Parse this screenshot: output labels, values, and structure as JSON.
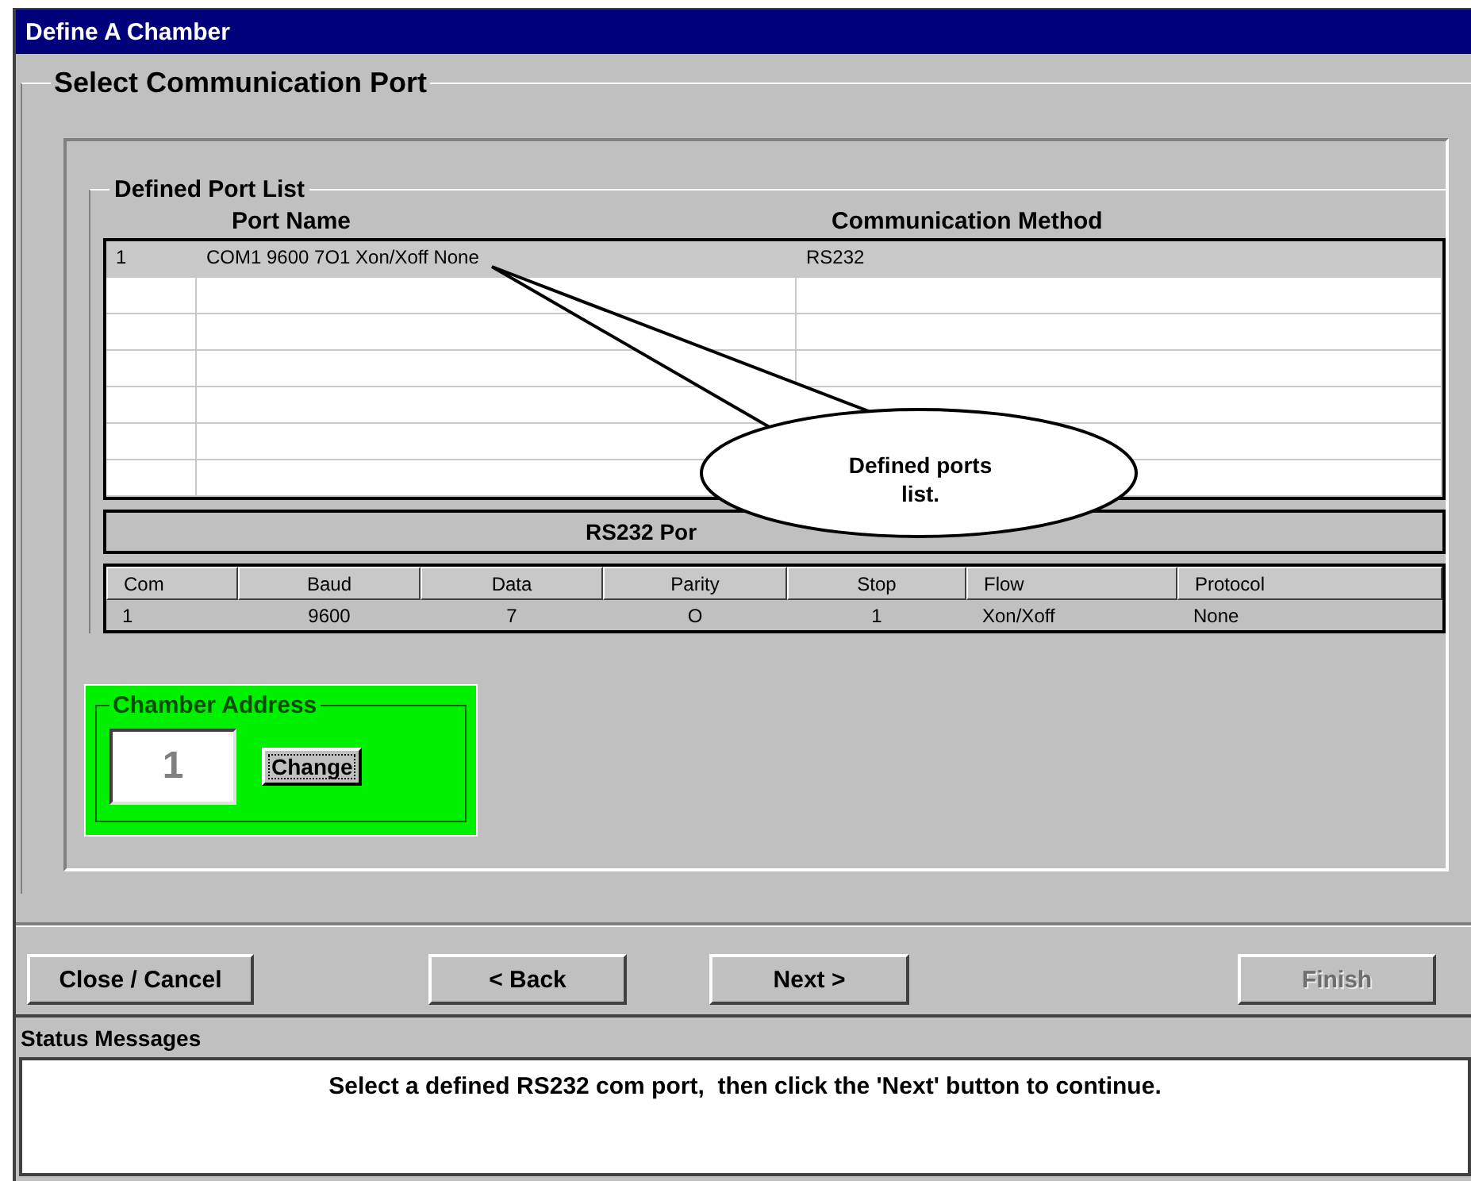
{
  "window": {
    "title": "Define A Chamber"
  },
  "section_title": "Select Communication Port",
  "port_list": {
    "title": "Defined Port List",
    "columns": [
      "Port Name",
      "Communication Method"
    ],
    "rows": [
      {
        "number": "1",
        "port_name": "COM1 9600 7O1 Xon/Xoff None",
        "method": "RS232",
        "selected": true
      }
    ],
    "callout": "Defined ports list."
  },
  "rs232": {
    "title": "RS232 Por",
    "columns": [
      "Com",
      "Baud",
      "Data",
      "Parity",
      "Stop",
      "Flow",
      "Protocol"
    ],
    "rows": [
      [
        "1",
        "9600",
        "7",
        "O",
        "1",
        "Xon/Xoff",
        "None"
      ]
    ]
  },
  "chamber_address": {
    "title": "Chamber Address",
    "value": "1",
    "button": "Change"
  },
  "buttons": [
    {
      "label": "Close / Cancel",
      "disabled": false
    },
    {
      "label": "< Back",
      "disabled": false
    },
    {
      "label": "Next >",
      "disabled": false
    },
    {
      "label": "Finish",
      "disabled": true
    }
  ],
  "status": {
    "title": "Status Messages",
    "message": "Select a defined RS232 com port,  then click the 'Next' button to continue."
  }
}
